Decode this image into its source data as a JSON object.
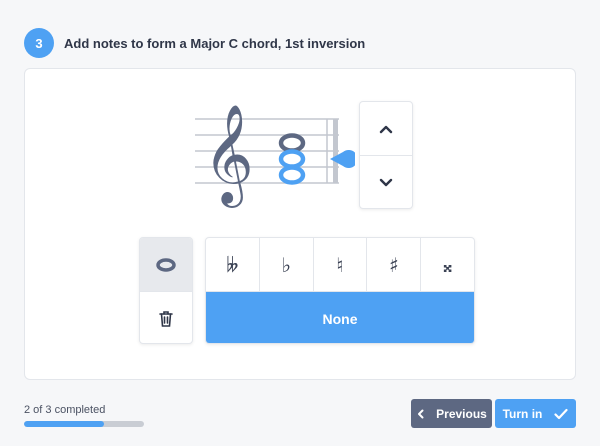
{
  "header": {
    "step_number": "3",
    "title": "Add notes to form a Major C chord, 1st inversion"
  },
  "colors": {
    "accent": "#4ea1f3",
    "staff_ink": "#5d6882",
    "secondary_button": "#5d6882"
  },
  "staff": {
    "clef": "treble-clef-icon",
    "notes": [
      "C",
      "E",
      "G"
    ],
    "selected_note": "E"
  },
  "pitch_controls": {
    "up_icon": "chevron-up-icon",
    "down_icon": "chevron-down-icon"
  },
  "note_tools": {
    "whole_note_icon": "whole-note-icon",
    "delete_icon": "trash-icon"
  },
  "accidentals": {
    "options": [
      {
        "name": "double-flat",
        "glyph": "𝄫"
      },
      {
        "name": "flat",
        "glyph": "♭"
      },
      {
        "name": "natural",
        "glyph": "♮"
      },
      {
        "name": "sharp",
        "glyph": "♯"
      },
      {
        "name": "double-sharp",
        "glyph": "𝄪"
      }
    ],
    "none_label": "None"
  },
  "footer": {
    "progress_text": "2 of 3 completed",
    "progress_fraction": 0.667,
    "previous_label": "Previous",
    "turn_in_label": "Turn in"
  }
}
